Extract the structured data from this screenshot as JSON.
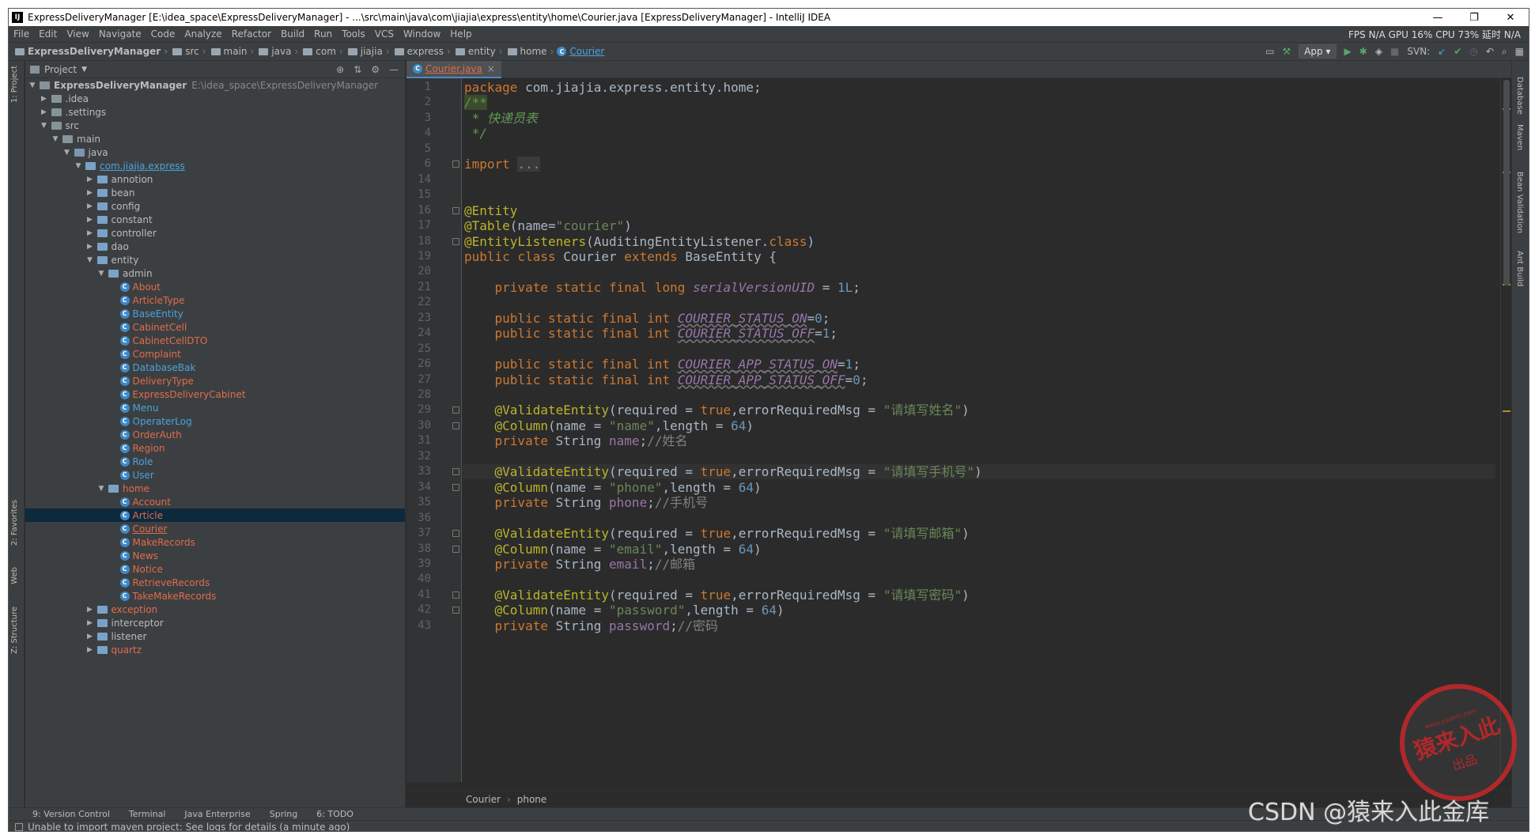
{
  "window": {
    "title": "ExpressDeliveryManager [E:\\idea_space\\ExpressDeliveryManager] - ...\\src\\main\\java\\com\\jiajia\\express\\entity\\home\\Courier.java [ExpressDeliveryManager] - IntelliJ IDEA",
    "logo": "IJ"
  },
  "menu": [
    "File",
    "Edit",
    "View",
    "Navigate",
    "Code",
    "Analyze",
    "Refactor",
    "Build",
    "Run",
    "Tools",
    "VCS",
    "Window",
    "Help"
  ],
  "stats": "FPS N/A GPU 16% CPU 73% 延时 N/A",
  "breadcrumbs": [
    "ExpressDeliveryManager",
    "src",
    "main",
    "java",
    "com",
    "jiajia",
    "express",
    "entity",
    "home",
    "Courier"
  ],
  "toolbar": {
    "run_config": "App",
    "svn_label": "SVN:"
  },
  "left_tabs": [
    "1: Project",
    "2: Favorites",
    "Web",
    "Z: Structure"
  ],
  "right_tabs": [
    "Database",
    "Maven",
    "Bean Validation",
    "Ant Build"
  ],
  "project_panel": {
    "title": "Project"
  },
  "tree": [
    {
      "indent": 0,
      "arrow": "▼",
      "type": "folder",
      "label": "ExpressDeliveryManager",
      "extra": "E:\\idea_space\\ExpressDeliveryManager",
      "bold": true
    },
    {
      "indent": 1,
      "arrow": "▶",
      "type": "folder",
      "label": ".idea"
    },
    {
      "indent": 1,
      "arrow": "▶",
      "type": "folder",
      "label": ".settings"
    },
    {
      "indent": 1,
      "arrow": "▼",
      "type": "folder",
      "label": "src"
    },
    {
      "indent": 2,
      "arrow": "▼",
      "type": "folder",
      "label": "main"
    },
    {
      "indent": 3,
      "arrow": "▼",
      "type": "src",
      "label": "java"
    },
    {
      "indent": 4,
      "arrow": "▼",
      "type": "pkg",
      "label": "com.jiajia.express",
      "color": "blue",
      "underline": true
    },
    {
      "indent": 5,
      "arrow": "▶",
      "type": "pkg",
      "label": "annotion"
    },
    {
      "indent": 5,
      "arrow": "▶",
      "type": "pkg",
      "label": "bean"
    },
    {
      "indent": 5,
      "arrow": "▶",
      "type": "pkg",
      "label": "config"
    },
    {
      "indent": 5,
      "arrow": "▶",
      "type": "pkg",
      "label": "constant"
    },
    {
      "indent": 5,
      "arrow": "▶",
      "type": "pkg",
      "label": "controller"
    },
    {
      "indent": 5,
      "arrow": "▶",
      "type": "pkg",
      "label": "dao"
    },
    {
      "indent": 5,
      "arrow": "▼",
      "type": "pkg",
      "label": "entity"
    },
    {
      "indent": 6,
      "arrow": "▼",
      "type": "pkg",
      "label": "admin"
    },
    {
      "indent": 7,
      "type": "class",
      "label": "About",
      "color": "red"
    },
    {
      "indent": 7,
      "type": "class",
      "label": "ArticleType",
      "color": "red"
    },
    {
      "indent": 7,
      "type": "class",
      "label": "BaseEntity",
      "color": "blue"
    },
    {
      "indent": 7,
      "type": "class",
      "label": "CabinetCell",
      "color": "red"
    },
    {
      "indent": 7,
      "type": "class",
      "label": "CabinetCellDTO",
      "color": "red"
    },
    {
      "indent": 7,
      "type": "class",
      "label": "Complaint",
      "color": "red"
    },
    {
      "indent": 7,
      "type": "class",
      "label": "DatabaseBak",
      "color": "blue"
    },
    {
      "indent": 7,
      "type": "class",
      "label": "DeliveryType",
      "color": "red"
    },
    {
      "indent": 7,
      "type": "class",
      "label": "ExpressDeliveryCabinet",
      "color": "red"
    },
    {
      "indent": 7,
      "type": "class",
      "label": "Menu",
      "color": "blue"
    },
    {
      "indent": 7,
      "type": "class",
      "label": "OperaterLog",
      "color": "blue"
    },
    {
      "indent": 7,
      "type": "class",
      "label": "OrderAuth",
      "color": "red"
    },
    {
      "indent": 7,
      "type": "class",
      "label": "Region",
      "color": "red"
    },
    {
      "indent": 7,
      "type": "class",
      "label": "Role",
      "color": "blue"
    },
    {
      "indent": 7,
      "type": "class",
      "label": "User",
      "color": "blue"
    },
    {
      "indent": 6,
      "arrow": "▼",
      "type": "pkg",
      "label": "home",
      "color": "red"
    },
    {
      "indent": 7,
      "type": "class",
      "label": "Account",
      "color": "red"
    },
    {
      "indent": 7,
      "type": "class",
      "label": "Article",
      "color": "red",
      "selected": true
    },
    {
      "indent": 7,
      "type": "class",
      "label": "Courier",
      "color": "red",
      "underline": true
    },
    {
      "indent": 7,
      "type": "class",
      "label": "MakeRecords",
      "color": "red"
    },
    {
      "indent": 7,
      "type": "class",
      "label": "News",
      "color": "red"
    },
    {
      "indent": 7,
      "type": "class",
      "label": "Notice",
      "color": "red"
    },
    {
      "indent": 7,
      "type": "class",
      "label": "RetrieveRecords",
      "color": "red"
    },
    {
      "indent": 7,
      "type": "class",
      "label": "TakeMakeRecords",
      "color": "red"
    },
    {
      "indent": 5,
      "arrow": "▶",
      "type": "pkg",
      "label": "exception",
      "color": "red"
    },
    {
      "indent": 5,
      "arrow": "▶",
      "type": "pkg",
      "label": "interceptor"
    },
    {
      "indent": 5,
      "arrow": "▶",
      "type": "pkg",
      "label": "listener"
    },
    {
      "indent": 5,
      "arrow": "▶",
      "type": "pkg",
      "label": "quartz",
      "color": "red"
    }
  ],
  "editor": {
    "tab": "Courier.java",
    "lines": [
      {
        "n": "1",
        "html": "<span class='kw'>package</span> com.jiajia.express.entity.home;"
      },
      {
        "n": "2",
        "html": "<span class='cm' style='background:#3b4b2b'>/**</span>"
      },
      {
        "n": "3",
        "html": "<span class='cm'> * 快递员表</span>"
      },
      {
        "n": "4",
        "html": "<span class='cm'> */</span>"
      },
      {
        "n": "5",
        "html": ""
      },
      {
        "n": "6",
        "html": "<span class='kw'>import</span> <span style='background:#3a3a3a;color:#8a8a8a'>...</span>",
        "fold": true
      },
      {
        "n": "14",
        "html": ""
      },
      {
        "n": "15",
        "html": ""
      },
      {
        "n": "16",
        "html": "<span class='ann'>@Entity</span>",
        "fold": true
      },
      {
        "n": "17",
        "html": "<span class='ann'>@Table</span>(name=<span class='str'>\"courier\"</span>)"
      },
      {
        "n": "18",
        "html": "<span class='ann'>@EntityListeners</span>(AuditingEntityListener.<span class='kw'>class</span>)",
        "fold": true
      },
      {
        "n": "19",
        "html": "<span class='kw'>public class</span> Courier <span class='kw'>extends</span> BaseEntity {"
      },
      {
        "n": "20",
        "html": ""
      },
      {
        "n": "21",
        "html": "    <span class='kw'>private static final long</span> <span class='sfld2'>serialVersionUID</span> = <span class='num'>1L</span>;"
      },
      {
        "n": "22",
        "html": ""
      },
      {
        "n": "23",
        "html": "    <span class='kw'>public static final int</span> <span class='sfld'>COURIER_STATUS_ON</span>=<span class='num'>0</span>;"
      },
      {
        "n": "24",
        "html": "    <span class='kw'>public static final int</span> <span class='sfld'>COURIER_STATUS_OFF</span>=<span class='num'>1</span>;"
      },
      {
        "n": "25",
        "html": ""
      },
      {
        "n": "26",
        "html": "    <span class='kw'>public static final int</span> <span class='sfld'>COURIER_APP_STATUS_ON</span>=<span class='num'>1</span>;"
      },
      {
        "n": "27",
        "html": "    <span class='kw'>public static final int</span> <span class='sfld'>COURIER_APP_STATUS_OFF</span>=<span class='num'>0</span>;"
      },
      {
        "n": "28",
        "html": ""
      },
      {
        "n": "29",
        "html": "    <span class='ann'>@ValidateEntity</span>(required = <span class='kw'>true</span>,errorRequiredMsg = <span class='str'>\"请填写姓名\"</span>)",
        "fold": true
      },
      {
        "n": "30",
        "html": "    <span class='ann'>@Column</span>(name = <span class='str'>\"name\"</span>,length = <span class='num'>64</span>)",
        "fold": true
      },
      {
        "n": "31",
        "html": "    <span class='kw'>private</span> String <span class='fld'>name</span>;<span class='cmt'>//姓名</span>"
      },
      {
        "n": "32",
        "html": ""
      },
      {
        "n": "33",
        "html": "    <span class='ann'>@ValidateEntity</span>(required = <span class='kw'>true</span>,errorRequiredMsg = <span class='str'>\"请填写手机号\"</span>)",
        "fold": true,
        "current": true
      },
      {
        "n": "34",
        "html": "    <span class='ann'>@Column</span>(name = <span class='str'>\"phone\"</span>,length = <span class='num'>64</span>)",
        "fold": true
      },
      {
        "n": "35",
        "html": "    <span class='kw'>private</span> String <span class='fld'>phone</span>;<span class='cmt'>//手机号</span>"
      },
      {
        "n": "36",
        "html": ""
      },
      {
        "n": "37",
        "html": "    <span class='ann'>@ValidateEntity</span>(required = <span class='kw'>true</span>,errorRequiredMsg = <span class='str'>\"请填写邮箱\"</span>)",
        "fold": true
      },
      {
        "n": "38",
        "html": "    <span class='ann'>@Column</span>(name = <span class='str'>\"email\"</span>,length = <span class='num'>64</span>)",
        "fold": true
      },
      {
        "n": "39",
        "html": "    <span class='kw'>private</span> String <span class='fld'>email</span>;<span class='cmt'>//邮箱</span>"
      },
      {
        "n": "40",
        "html": ""
      },
      {
        "n": "41",
        "html": "    <span class='ann'>@ValidateEntity</span>(required = <span class='kw'>true</span>,errorRequiredMsg = <span class='str'>\"请填写密码\"</span>)",
        "fold": true
      },
      {
        "n": "42",
        "html": "    <span class='ann'>@Column</span>(name = <span class='str'>\"password\"</span>,length = <span class='num'>64</span>)",
        "fold": true
      },
      {
        "n": "43",
        "html": "    <span class='kw'>private</span> String <span class='fld'>password</span>;<span class='cmt'>//密码</span>"
      }
    ],
    "breadcrumb": [
      "Courier",
      "phone"
    ]
  },
  "bottom_tabs": [
    "9: Version Control",
    "Terminal",
    "Java Enterprise",
    "Spring",
    "6: TODO"
  ],
  "status": "Unable to import maven project: See logs for details (a minute ago)",
  "stamp": {
    "main": "猿来入此",
    "sub": "出品",
    "url": "www.yuanrc.com"
  },
  "watermark": "CSDN @猿来入此金库"
}
